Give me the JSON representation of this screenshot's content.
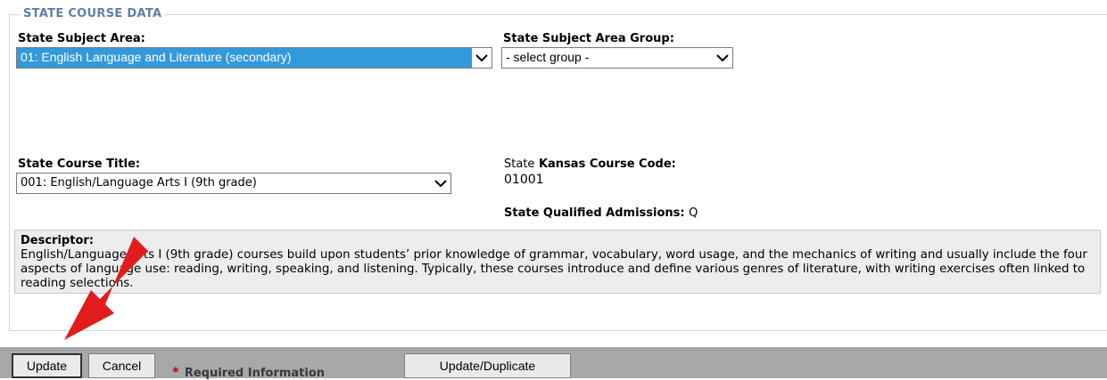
{
  "section": {
    "legend": "STATE COURSE DATA"
  },
  "subject_area": {
    "label": "State Subject Area:",
    "selected": "01: English Language and Literature (secondary)"
  },
  "subject_group": {
    "label": "State Subject Area Group:",
    "selected": "- select group -"
  },
  "course_title": {
    "label": "State Course Title:",
    "selected": "001: English/Language Arts I (9th grade)"
  },
  "course_code": {
    "label_prefix": "State",
    "label_bold": "Kansas Course Code:",
    "value": "01001"
  },
  "qualified_admissions": {
    "label": "State Qualified Admissions:",
    "value": "Q"
  },
  "descriptor": {
    "label": "Descriptor:",
    "text": "English/Language Arts I (9th grade) courses build upon students’ prior knowledge of grammar, vocabulary, word usage, and the mechanics of writing and usually include the four aspects of language use: reading, writing, speaking, and listening. Typically, these courses introduce and define various genres of literature, with writing exercises often linked to reading selections."
  },
  "footer": {
    "update_label": "Update",
    "cancel_label": "Cancel",
    "required_star": "*",
    "required_text": "Required Information",
    "update_duplicate_label": "Update/Duplicate"
  },
  "colors": {
    "legend": "#5f7fa8",
    "highlight": "#3399dd",
    "arrow": "#e21b1b",
    "footer": "#a8a8a8"
  },
  "icons": {
    "dropdown": "chevron-down-icon",
    "annotation": "red-arrow-icon"
  }
}
